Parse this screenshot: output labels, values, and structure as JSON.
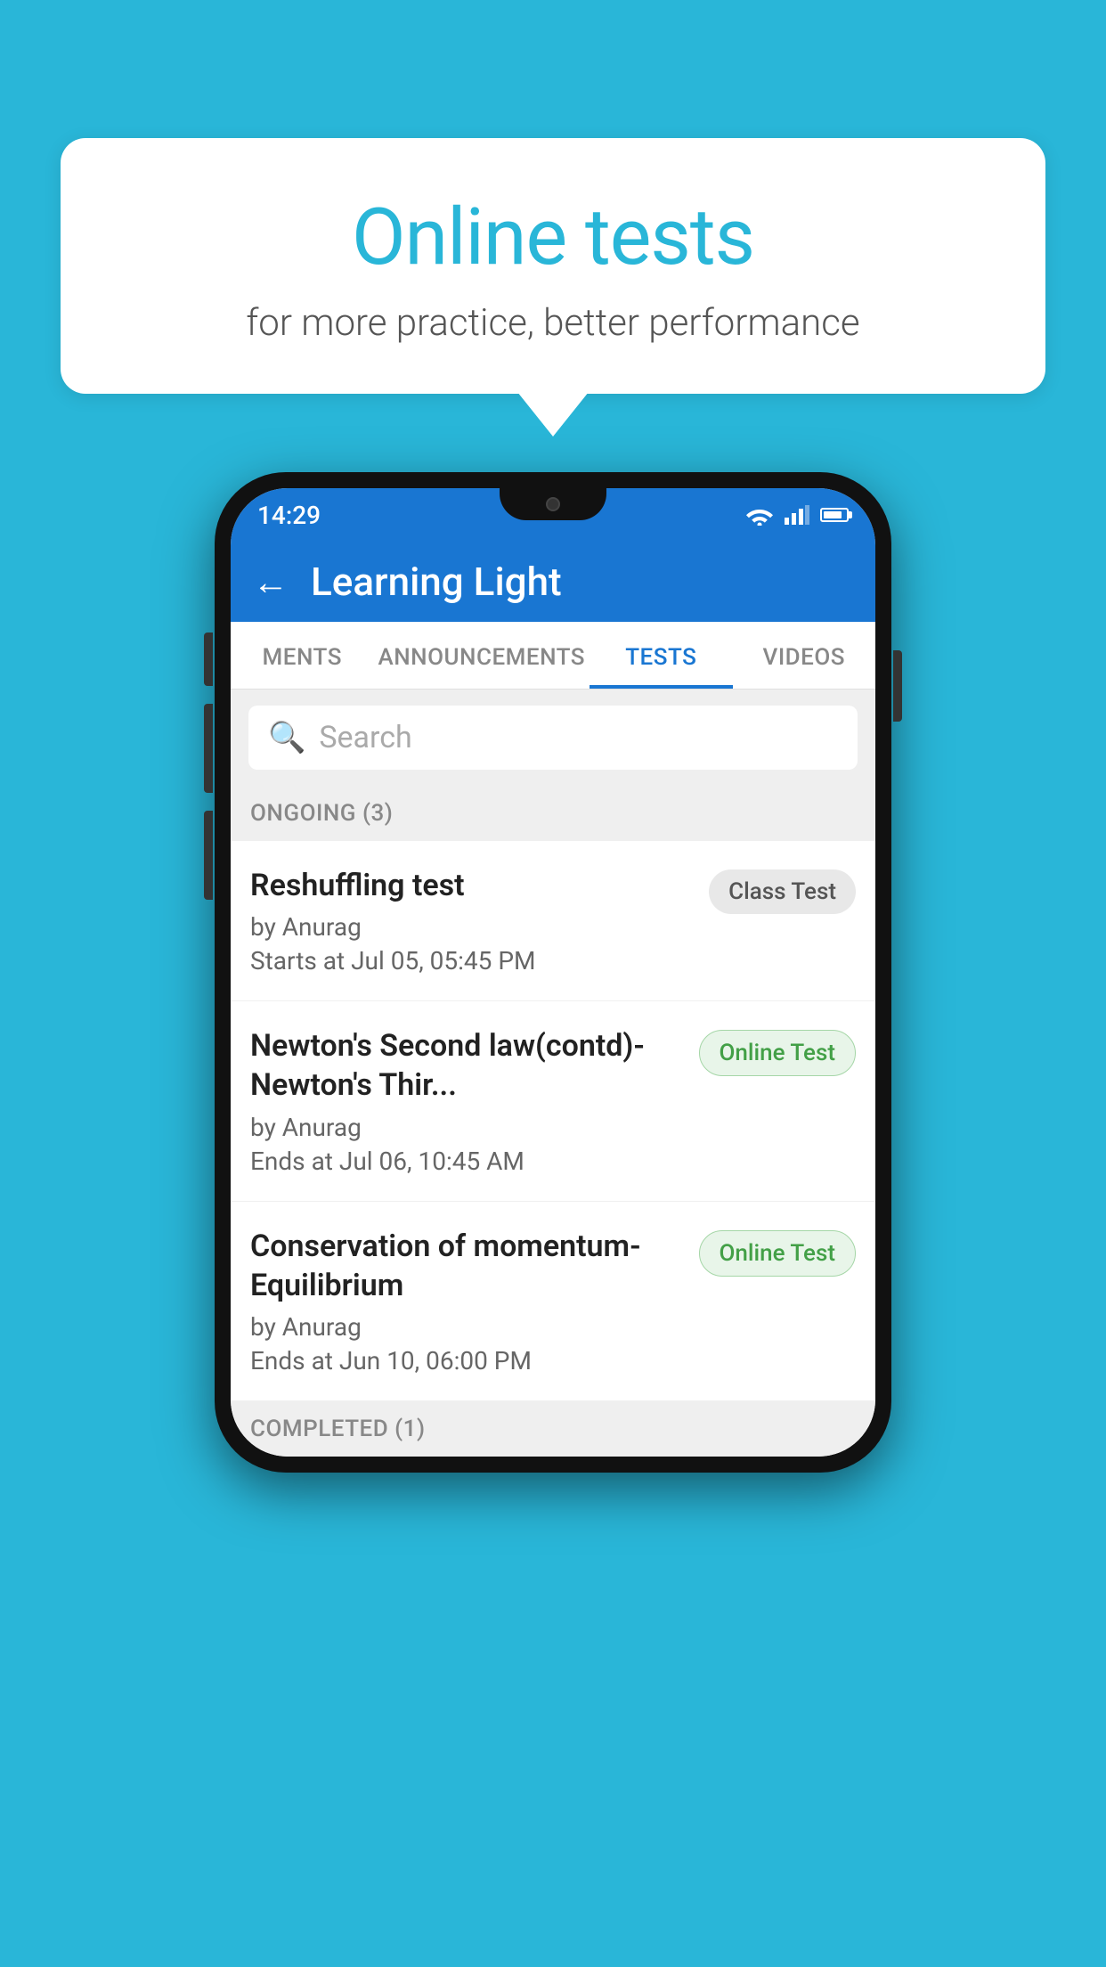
{
  "background_color": "#29b6d8",
  "speech_bubble": {
    "title": "Online tests",
    "subtitle": "for more practice, better performance"
  },
  "phone": {
    "status_bar": {
      "time": "14:29",
      "signal_icons": "▼◄▌"
    },
    "app_header": {
      "title": "Learning Light",
      "back_label": "←"
    },
    "tabs": [
      {
        "label": "MENTS",
        "active": false
      },
      {
        "label": "ANNOUNCEMENTS",
        "active": false
      },
      {
        "label": "TESTS",
        "active": true
      },
      {
        "label": "VIDEOS",
        "active": false
      }
    ],
    "search": {
      "placeholder": "Search"
    },
    "sections": [
      {
        "header": "ONGOING (3)",
        "tests": [
          {
            "title": "Reshuffling test",
            "author": "by Anurag",
            "date": "Starts at  Jul 05, 05:45 PM",
            "badge": "Class Test",
            "badge_type": "class"
          },
          {
            "title": "Newton's Second law(contd)-Newton's Thir...",
            "author": "by Anurag",
            "date": "Ends at  Jul 06, 10:45 AM",
            "badge": "Online Test",
            "badge_type": "online"
          },
          {
            "title": "Conservation of momentum-Equilibrium",
            "author": "by Anurag",
            "date": "Ends at  Jun 10, 06:00 PM",
            "badge": "Online Test",
            "badge_type": "online"
          }
        ]
      }
    ],
    "completed_section_label": "COMPLETED (1)"
  }
}
